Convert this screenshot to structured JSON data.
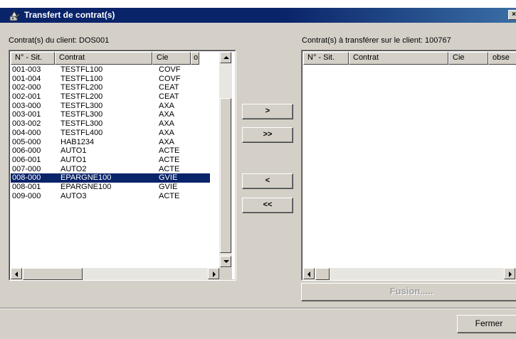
{
  "window": {
    "title": "Transfert de contrat(s)",
    "close_glyph": "×"
  },
  "left_panel": {
    "label": "Contrat(s) du client: DOS001",
    "columns": [
      "N° - Sit.",
      "Contrat",
      "Cie",
      "o"
    ],
    "rows": [
      {
        "sit": "001-003",
        "contrat": "TESTFL100",
        "cie": "COVF"
      },
      {
        "sit": "001-004",
        "contrat": "TESTFL100",
        "cie": "COVF"
      },
      {
        "sit": "002-000",
        "contrat": "TESTFL200",
        "cie": "CEAT"
      },
      {
        "sit": "002-001",
        "contrat": "TESTFL200",
        "cie": "CEAT"
      },
      {
        "sit": "003-000",
        "contrat": "TESTFL300",
        "cie": "AXA"
      },
      {
        "sit": "003-001",
        "contrat": "TESTFL300",
        "cie": "AXA"
      },
      {
        "sit": "003-002",
        "contrat": "TESTFL300",
        "cie": "AXA"
      },
      {
        "sit": "004-000",
        "contrat": "TESTFL400",
        "cie": "AXA"
      },
      {
        "sit": "005-000",
        "contrat": "HAB1234",
        "cie": "AXA"
      },
      {
        "sit": "006-000",
        "contrat": "AUTO1",
        "cie": "ACTE"
      },
      {
        "sit": "006-001",
        "contrat": "AUTO1",
        "cie": "ACTE"
      },
      {
        "sit": "007-000",
        "contrat": "AUTO2",
        "cie": "ACTE"
      },
      {
        "sit": "008-000",
        "contrat": "EPARGNE100",
        "cie": "GVIE"
      },
      {
        "sit": "008-001",
        "contrat": "EPARGNE100",
        "cie": "GVIE"
      },
      {
        "sit": "009-000",
        "contrat": "AUTO3",
        "cie": "ACTE"
      }
    ],
    "selected_index": 12
  },
  "right_panel": {
    "label": "Contrat(s) à transférer sur le client: 100767",
    "columns": [
      "N° - Sit.",
      "Contrat",
      "Cie",
      "obse"
    ],
    "rows": []
  },
  "buttons": {
    "move_one_right": ">",
    "move_all_right": ">>",
    "move_one_left": "<",
    "move_all_left": "<<",
    "fusion": "Fusion.....",
    "fermer": "Fermer"
  },
  "colors": {
    "title_bar": "#0a246a",
    "selection": "#0a246a",
    "dialog_bg": "#d4d0c8"
  }
}
